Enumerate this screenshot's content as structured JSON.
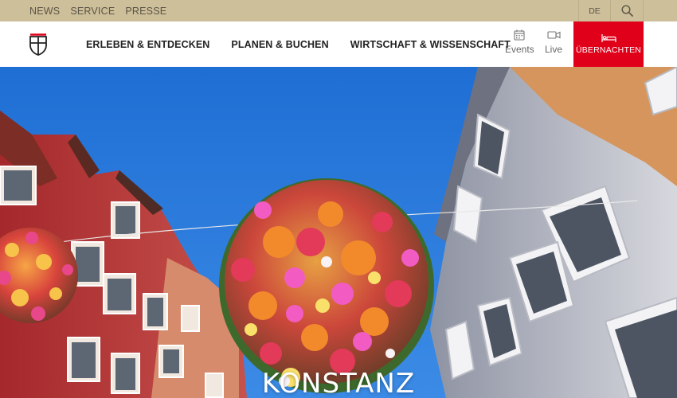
{
  "topbar": {
    "links": [
      "NEWS",
      "SERVICE",
      "PRESSE"
    ],
    "language": "DE",
    "search_icon": "search-icon"
  },
  "header": {
    "logo_icon": "konstanz-coat-of-arms-icon",
    "nav": [
      "ERLEBEN & ENTDECKEN",
      "PLANEN & BUCHEN",
      "WIRTSCHAFT & WISSENSCHAFT"
    ],
    "events_label": "Events",
    "events_icon": "calendar-icon",
    "live_label": "Live",
    "live_icon": "video-camera-icon",
    "book_label": "ÜBERNACHTEN",
    "book_icon": "bed-icon"
  },
  "hero": {
    "title": "KONSTANZ"
  },
  "colors": {
    "topbar": "#cdbf9a",
    "accent": "#e1001a",
    "text_dark": "#222222",
    "text_muted": "#666666"
  }
}
